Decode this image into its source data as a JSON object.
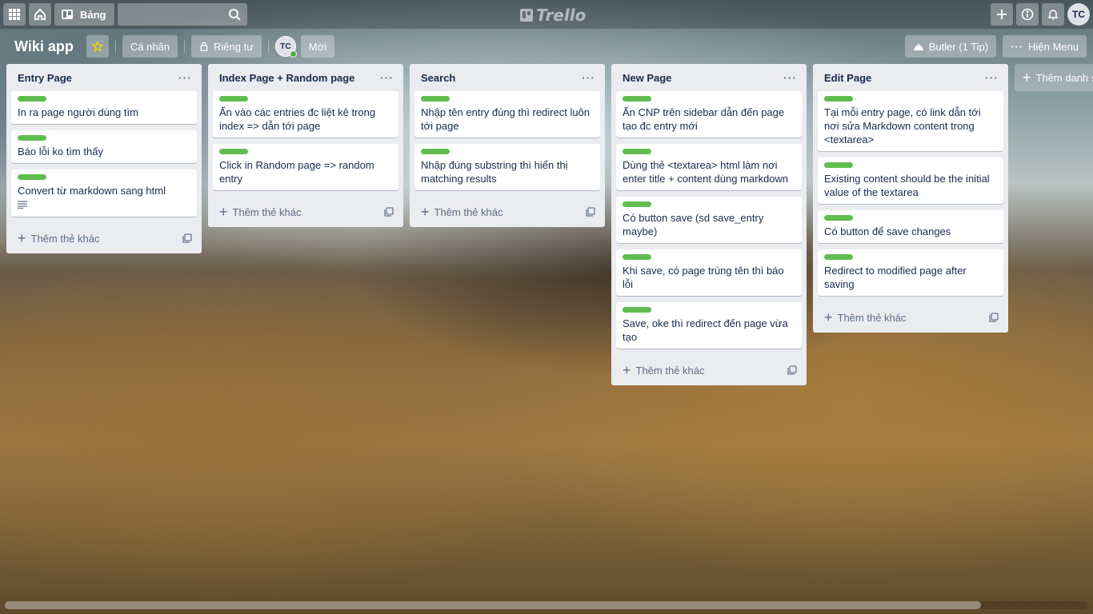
{
  "header": {
    "boards_label": "Bảng",
    "search_placeholder": "",
    "logo_text": "Trello",
    "user_initials": "TC"
  },
  "board": {
    "title": "Wiki app",
    "team_label": "Cá nhân",
    "visibility_label": "Riêng tư",
    "member_initials": "TC",
    "invite_label": "Mời",
    "butler_label": "Butler (1 Tip)",
    "menu_label": "Hiện Menu",
    "add_list_label": "Thêm danh sách khác"
  },
  "lists": [
    {
      "title": "Entry Page",
      "cards": [
        "In ra page người dùng tìm",
        "Báo lỗi ko tìm thấy",
        "Convert từ markdown sang html"
      ],
      "add_card_label": "Thêm thẻ khác"
    },
    {
      "title": "Index Page + Random page",
      "cards": [
        "Ấn vào các entries đc liệt kê trong index => dẫn tới page",
        "Click in Random page => random entry"
      ],
      "add_card_label": "Thêm thẻ khác"
    },
    {
      "title": "Search",
      "cards": [
        "Nhập tên entry đúng thì redirect luôn tới page",
        "Nhập đúng substring thì hiển thị matching results"
      ],
      "add_card_label": "Thêm thẻ khác"
    },
    {
      "title": "New Page",
      "cards": [
        "Ấn CNP trên sidebar dẫn đến page tạo đc entry mới",
        "Dùng thẻ <textarea> html làm nơi enter title + content dùng markdown",
        "Có button save (sd save_entry maybe)",
        "Khi save, có page trùng tên thì báo lỗi",
        "Save, oke thì redirect đến page vừa tạo"
      ],
      "add_card_label": "Thêm thẻ khác"
    },
    {
      "title": "Edit Page",
      "cards": [
        "Tại mỗi entry page, có link dẫn tới nơi sửa Markdown content trong <textarea>",
        "Existing content should be the initial value of the textarea",
        "Có button để save changes",
        "Redirect to modified page after saving"
      ],
      "add_card_label": "Thêm thẻ khác"
    }
  ],
  "colors": {
    "label_green": "#61bd4f",
    "list_bg": "#ebecf0"
  }
}
